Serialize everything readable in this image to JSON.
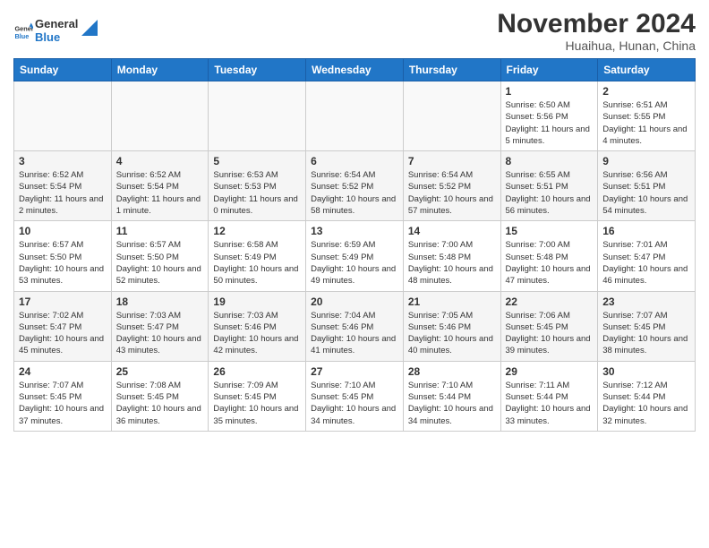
{
  "header": {
    "logo_general": "General",
    "logo_blue": "Blue",
    "title": "November 2024",
    "subtitle": "Huaihua, Hunan, China"
  },
  "weekdays": [
    "Sunday",
    "Monday",
    "Tuesday",
    "Wednesday",
    "Thursday",
    "Friday",
    "Saturday"
  ],
  "weeks": [
    [
      {
        "day": "",
        "empty": true
      },
      {
        "day": "",
        "empty": true
      },
      {
        "day": "",
        "empty": true
      },
      {
        "day": "",
        "empty": true
      },
      {
        "day": "",
        "empty": true
      },
      {
        "day": "1",
        "sunrise": "6:50 AM",
        "sunset": "5:56 PM",
        "daylight": "11 hours and 5 minutes."
      },
      {
        "day": "2",
        "sunrise": "6:51 AM",
        "sunset": "5:55 PM",
        "daylight": "11 hours and 4 minutes."
      }
    ],
    [
      {
        "day": "3",
        "sunrise": "6:52 AM",
        "sunset": "5:54 PM",
        "daylight": "11 hours and 2 minutes."
      },
      {
        "day": "4",
        "sunrise": "6:52 AM",
        "sunset": "5:54 PM",
        "daylight": "11 hours and 1 minute."
      },
      {
        "day": "5",
        "sunrise": "6:53 AM",
        "sunset": "5:53 PM",
        "daylight": "11 hours and 0 minutes."
      },
      {
        "day": "6",
        "sunrise": "6:54 AM",
        "sunset": "5:52 PM",
        "daylight": "10 hours and 58 minutes."
      },
      {
        "day": "7",
        "sunrise": "6:54 AM",
        "sunset": "5:52 PM",
        "daylight": "10 hours and 57 minutes."
      },
      {
        "day": "8",
        "sunrise": "6:55 AM",
        "sunset": "5:51 PM",
        "daylight": "10 hours and 56 minutes."
      },
      {
        "day": "9",
        "sunrise": "6:56 AM",
        "sunset": "5:51 PM",
        "daylight": "10 hours and 54 minutes."
      }
    ],
    [
      {
        "day": "10",
        "sunrise": "6:57 AM",
        "sunset": "5:50 PM",
        "daylight": "10 hours and 53 minutes."
      },
      {
        "day": "11",
        "sunrise": "6:57 AM",
        "sunset": "5:50 PM",
        "daylight": "10 hours and 52 minutes."
      },
      {
        "day": "12",
        "sunrise": "6:58 AM",
        "sunset": "5:49 PM",
        "daylight": "10 hours and 50 minutes."
      },
      {
        "day": "13",
        "sunrise": "6:59 AM",
        "sunset": "5:49 PM",
        "daylight": "10 hours and 49 minutes."
      },
      {
        "day": "14",
        "sunrise": "7:00 AM",
        "sunset": "5:48 PM",
        "daylight": "10 hours and 48 minutes."
      },
      {
        "day": "15",
        "sunrise": "7:00 AM",
        "sunset": "5:48 PM",
        "daylight": "10 hours and 47 minutes."
      },
      {
        "day": "16",
        "sunrise": "7:01 AM",
        "sunset": "5:47 PM",
        "daylight": "10 hours and 46 minutes."
      }
    ],
    [
      {
        "day": "17",
        "sunrise": "7:02 AM",
        "sunset": "5:47 PM",
        "daylight": "10 hours and 45 minutes."
      },
      {
        "day": "18",
        "sunrise": "7:03 AM",
        "sunset": "5:47 PM",
        "daylight": "10 hours and 43 minutes."
      },
      {
        "day": "19",
        "sunrise": "7:03 AM",
        "sunset": "5:46 PM",
        "daylight": "10 hours and 42 minutes."
      },
      {
        "day": "20",
        "sunrise": "7:04 AM",
        "sunset": "5:46 PM",
        "daylight": "10 hours and 41 minutes."
      },
      {
        "day": "21",
        "sunrise": "7:05 AM",
        "sunset": "5:46 PM",
        "daylight": "10 hours and 40 minutes."
      },
      {
        "day": "22",
        "sunrise": "7:06 AM",
        "sunset": "5:45 PM",
        "daylight": "10 hours and 39 minutes."
      },
      {
        "day": "23",
        "sunrise": "7:07 AM",
        "sunset": "5:45 PM",
        "daylight": "10 hours and 38 minutes."
      }
    ],
    [
      {
        "day": "24",
        "sunrise": "7:07 AM",
        "sunset": "5:45 PM",
        "daylight": "10 hours and 37 minutes."
      },
      {
        "day": "25",
        "sunrise": "7:08 AM",
        "sunset": "5:45 PM",
        "daylight": "10 hours and 36 minutes."
      },
      {
        "day": "26",
        "sunrise": "7:09 AM",
        "sunset": "5:45 PM",
        "daylight": "10 hours and 35 minutes."
      },
      {
        "day": "27",
        "sunrise": "7:10 AM",
        "sunset": "5:45 PM",
        "daylight": "10 hours and 34 minutes."
      },
      {
        "day": "28",
        "sunrise": "7:10 AM",
        "sunset": "5:44 PM",
        "daylight": "10 hours and 34 minutes."
      },
      {
        "day": "29",
        "sunrise": "7:11 AM",
        "sunset": "5:44 PM",
        "daylight": "10 hours and 33 minutes."
      },
      {
        "day": "30",
        "sunrise": "7:12 AM",
        "sunset": "5:44 PM",
        "daylight": "10 hours and 32 minutes."
      }
    ]
  ],
  "labels": {
    "sunrise": "Sunrise:",
    "sunset": "Sunset:",
    "daylight": "Daylight:"
  }
}
